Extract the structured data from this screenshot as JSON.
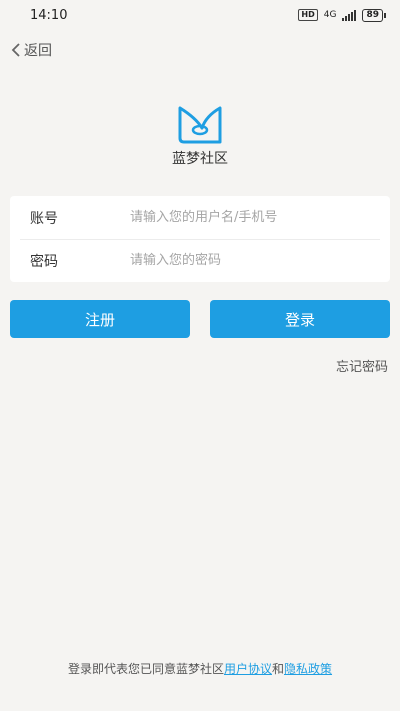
{
  "status_bar": {
    "time": "14:10",
    "hd": "HD",
    "network": "4G",
    "battery": "89"
  },
  "nav": {
    "back_label": "返回"
  },
  "app": {
    "name": "蓝梦社区",
    "brand_color": "#1e9ee2"
  },
  "form": {
    "account_label": "账号",
    "account_placeholder": "请输入您的用户名/手机号",
    "password_label": "密码",
    "password_placeholder": "请输入您的密码"
  },
  "buttons": {
    "register": "注册",
    "login": "登录"
  },
  "links": {
    "forgot_password": "忘记密码"
  },
  "footer": {
    "prefix": "登录即代表您已同意蓝梦社区",
    "user_agreement": "用户协议",
    "conjunction": "和",
    "privacy_policy": "隐私政策"
  }
}
